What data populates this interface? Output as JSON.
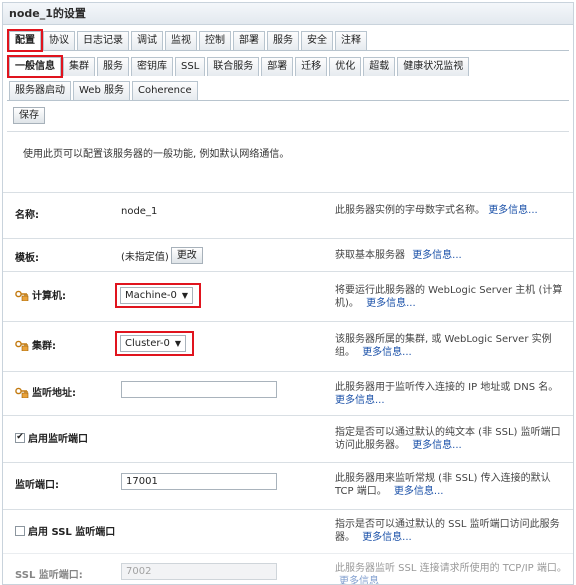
{
  "window": {
    "title": "node_1的设置"
  },
  "tabs_main": [
    {
      "label": "配置"
    },
    {
      "label": "协议"
    },
    {
      "label": "日志记录"
    },
    {
      "label": "调试"
    },
    {
      "label": "监视"
    },
    {
      "label": "控制"
    },
    {
      "label": "部署"
    },
    {
      "label": "服务"
    },
    {
      "label": "安全"
    },
    {
      "label": "注释"
    }
  ],
  "tabs_sub": [
    {
      "label": "一般信息"
    },
    {
      "label": "集群"
    },
    {
      "label": "服务"
    },
    {
      "label": "密钥库"
    },
    {
      "label": "SSL"
    },
    {
      "label": "联合服务"
    },
    {
      "label": "部署"
    },
    {
      "label": "迁移"
    },
    {
      "label": "优化"
    },
    {
      "label": "超载"
    },
    {
      "label": "健康状况监视"
    }
  ],
  "tabs_sub2": [
    {
      "label": "服务器启动"
    },
    {
      "label": "Web 服务"
    },
    {
      "label": "Coherence"
    }
  ],
  "toolbar": {
    "save_label": "保存"
  },
  "intro": "使用此页可以配置该服务器的一般功能, 例如默认网络通信。",
  "fields": {
    "name": {
      "label": "名称:",
      "value": "node_1",
      "help": "此服务器实例的字母数字式名称。",
      "more": "更多信息..."
    },
    "template": {
      "label": "模板:",
      "value": "(未指定值)",
      "change": "更改",
      "help": "获取基本服务器",
      "more": "更多信息..."
    },
    "machine": {
      "label": "计算机:",
      "value": "Machine-0",
      "help": "将要运行此服务器的 WebLogic Server 主机 (计算机)。",
      "more": "更多信息..."
    },
    "cluster": {
      "label": "集群:",
      "value": "Cluster-0",
      "help": "该服务器所属的集群, 或 WebLogic Server 实例组。",
      "more": "更多信息..."
    },
    "listen_address": {
      "label": "监听地址:",
      "value": "",
      "help": "此服务器用于监听传入连接的 IP 地址或 DNS 名。",
      "more": "更多信息..."
    },
    "listen_port_enabled": {
      "label": "启用监听端口",
      "checked": "✔",
      "help": "指定是否可以通过默认的纯文本 (非 SSL) 监听端口访问此服务器。",
      "more": "更多信息..."
    },
    "listen_port": {
      "label": "监听端口:",
      "value": "17001",
      "help": "此服务器用来监听常规 (非 SSL) 传入连接的默认 TCP 端口。",
      "more": "更多信息..."
    },
    "ssl_enabled": {
      "label": "启用 SSL 监听端口",
      "checked": "",
      "help": "指示是否可以通过默认的 SSL 监听端口访问此服务器。",
      "more": "更多信息..."
    },
    "ssl_port": {
      "label": "SSL 监听端口:",
      "value": "7002",
      "help": "此服务器监听 SSL 连接请求所使用的 TCP/IP 端口。",
      "more": "更多信息"
    }
  },
  "colors": {
    "highlight": "#e0141e",
    "link": "#1a50a8"
  }
}
